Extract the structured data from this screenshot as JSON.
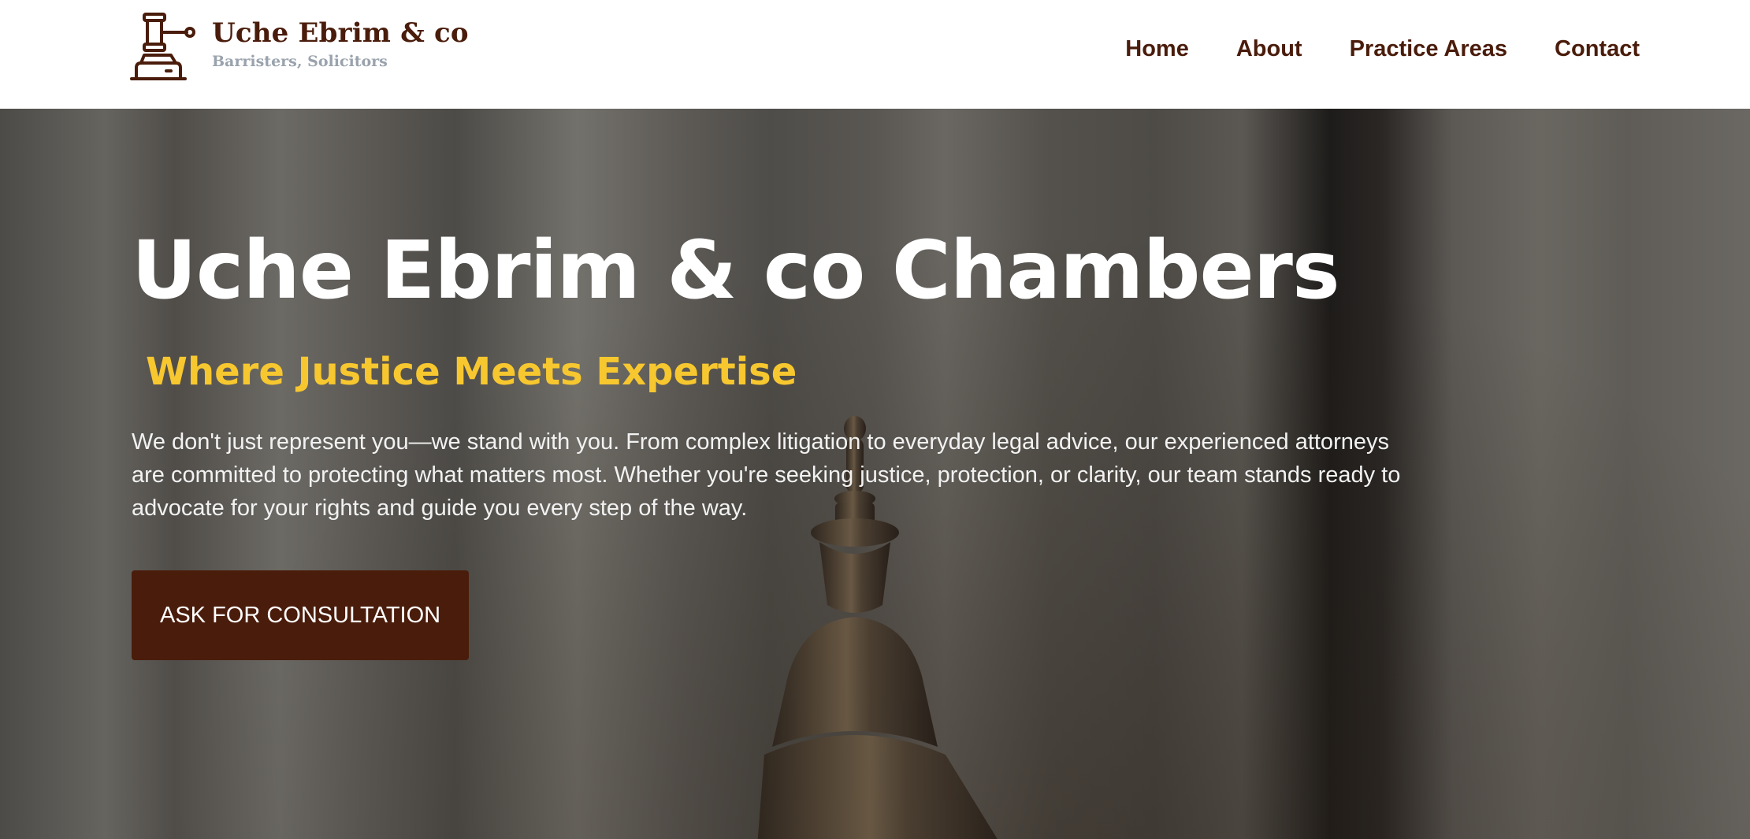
{
  "header": {
    "brand_name": "Uche Ebrim & co",
    "brand_tagline": "Barristers, Solicitors",
    "logo_icon": "gavel-icon",
    "nav": [
      {
        "label": "Home"
      },
      {
        "label": "About"
      },
      {
        "label": "Practice Areas"
      },
      {
        "label": "Contact"
      }
    ]
  },
  "hero": {
    "title": "Uche Ebrim & co Chambers",
    "subtitle": "Where Justice Meets Expertise",
    "description": "We don't just represent you—we stand with you. From complex litigation to everyday legal advice, our experienced attorneys are committed to protecting what matters most. Whether you're seeking justice, protection, or clarity, our team stands ready to advocate for your rights and guide you every step of the way.",
    "cta_label": "ASK FOR CONSULTATION"
  },
  "colors": {
    "brand": "#4a1c0b",
    "accent": "#f7c72f",
    "tagline": "#9aa3ad"
  }
}
